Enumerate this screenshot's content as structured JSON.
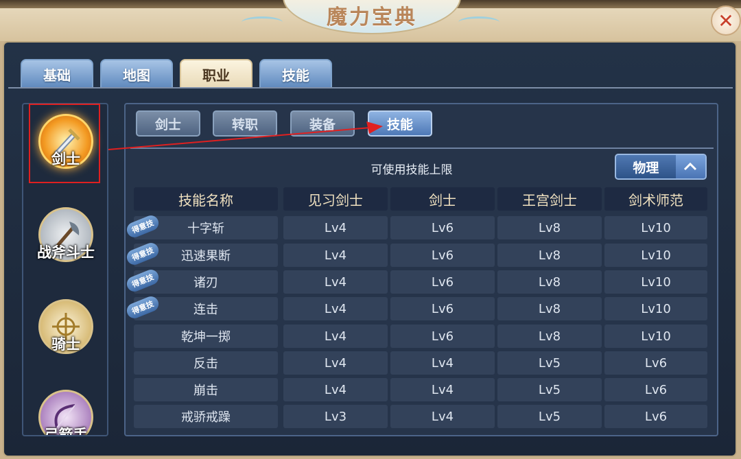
{
  "window": {
    "title": "魔力宝典",
    "close_symbol": "✕"
  },
  "main_tabs": [
    {
      "label": "基础",
      "active": false
    },
    {
      "label": "地图",
      "active": false
    },
    {
      "label": "职业",
      "active": true
    },
    {
      "label": "技能",
      "active": false
    }
  ],
  "classes": [
    {
      "label": "剑士",
      "icon": "sword-emblem-icon",
      "selected": true
    },
    {
      "label": "战斧斗士",
      "icon": "battle-axe-icon",
      "selected": false
    },
    {
      "label": "骑士",
      "icon": "knight-emblem-icon",
      "selected": false
    },
    {
      "label": "弓箭手",
      "icon": "bow-icon",
      "selected": false
    }
  ],
  "sub_tabs": [
    {
      "label": "剑士",
      "active": false
    },
    {
      "label": "转职",
      "active": false
    },
    {
      "label": "装备",
      "active": false
    },
    {
      "label": "技能",
      "active": true
    }
  ],
  "skill_limit_label": "可使用技能上限",
  "filter_dropdown": {
    "value": "物理",
    "icon": "chevron-up-icon"
  },
  "table": {
    "headers": [
      "技能名称",
      "见习剑士",
      "剑士",
      "王宫剑士",
      "剑术师范"
    ],
    "badge_text": "得意技",
    "rows": [
      {
        "name": "十字斩",
        "badge": true,
        "levels": [
          "Lv4",
          "Lv6",
          "Lv8",
          "Lv10"
        ]
      },
      {
        "name": "迅速果断",
        "badge": true,
        "levels": [
          "Lv4",
          "Lv6",
          "Lv8",
          "Lv10"
        ]
      },
      {
        "name": "诸刃",
        "badge": true,
        "levels": [
          "Lv4",
          "Lv6",
          "Lv8",
          "Lv10"
        ]
      },
      {
        "name": "连击",
        "badge": true,
        "levels": [
          "Lv4",
          "Lv6",
          "Lv8",
          "Lv10"
        ]
      },
      {
        "name": "乾坤一掷",
        "badge": false,
        "levels": [
          "Lv4",
          "Lv6",
          "Lv8",
          "Lv10"
        ]
      },
      {
        "name": "反击",
        "badge": false,
        "levels": [
          "Lv4",
          "Lv4",
          "Lv5",
          "Lv6"
        ]
      },
      {
        "name": "崩击",
        "badge": false,
        "levels": [
          "Lv4",
          "Lv4",
          "Lv5",
          "Lv6"
        ]
      },
      {
        "name": "戒骄戒躁",
        "badge": false,
        "levels": [
          "Lv3",
          "Lv4",
          "Lv5",
          "Lv6"
        ]
      }
    ]
  },
  "colors": {
    "panel_bg": "#233247",
    "annotation_red": "#e02020",
    "active_tab": "#4d78b6"
  }
}
